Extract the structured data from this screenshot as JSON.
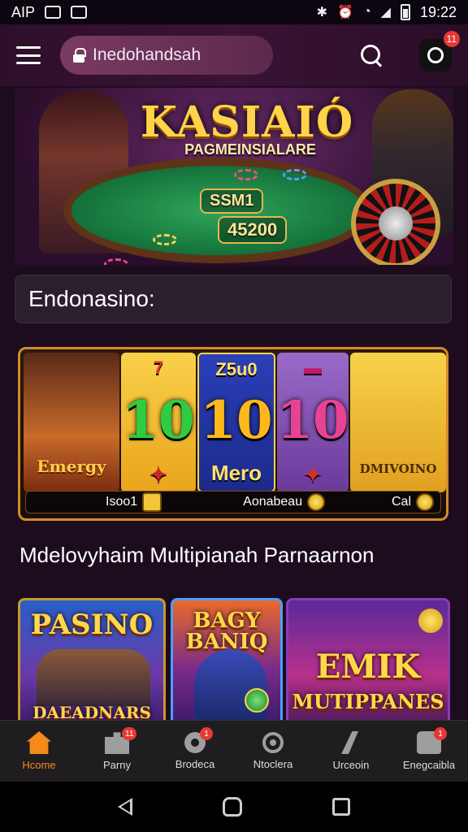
{
  "status_bar": {
    "left_text": "AIP",
    "time": "19:22"
  },
  "header": {
    "address": "Inedohandsah",
    "notification_count": "11"
  },
  "hero": {
    "title": "KASIAIÓ",
    "subtitle": "PAGMEINSIALARE",
    "table_label_1": "SSM1",
    "table_label_2": "45200"
  },
  "section1": {
    "title": "Endonasino:"
  },
  "slot_card": {
    "left_caption": "Emergy",
    "reel1": {
      "big": "10",
      "top": "7"
    },
    "reel2": {
      "big": "10",
      "top": "Z5u0",
      "bottom": "Mero"
    },
    "reel3": {
      "big": "10"
    },
    "right_caption": "DMIVOINO",
    "footer_left": "Isoo1",
    "footer_mid": "Aonabeau",
    "footer_right": "Cal"
  },
  "section2": {
    "title": "Mdelovyhaim Multipianah Parnaarnon"
  },
  "tiles": [
    {
      "title": "PASINO",
      "caption": "DAEADNARS"
    },
    {
      "title": "BAGY BANIQ"
    },
    {
      "title": "EMIK",
      "caption": "MUTIPPANES"
    }
  ],
  "bottom_nav": [
    {
      "label": "Hcome",
      "icon": "home-icon"
    },
    {
      "label": "Parny",
      "icon": "puzzle-icon",
      "badge": "11"
    },
    {
      "label": "Brodeca",
      "icon": "gear-icon",
      "badge": "1"
    },
    {
      "label": "Ntoclera",
      "icon": "target-icon"
    },
    {
      "label": "Urceoin",
      "icon": "chart-icon"
    },
    {
      "label": "Enegcaibla",
      "icon": "bag-icon",
      "badge": "1"
    }
  ],
  "colors": {
    "accent": "#f28a1c",
    "badge": "#e53935",
    "gold": "#ffd34a"
  }
}
